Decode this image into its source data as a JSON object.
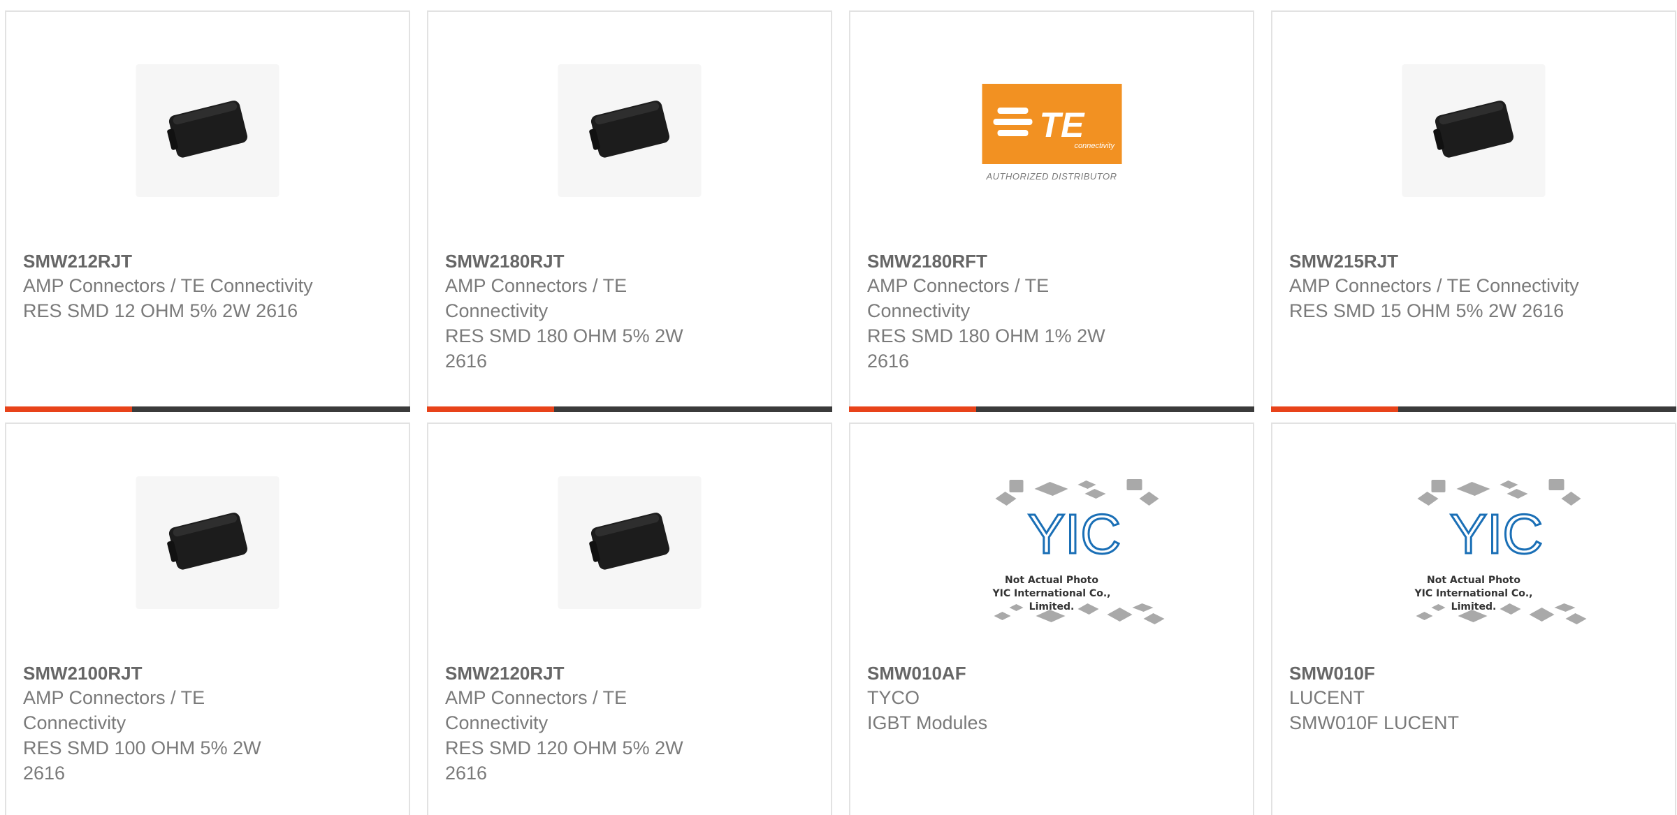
{
  "colors": {
    "accent": "#e8431a",
    "bar_dark": "#3b3b3b",
    "te_orange": "#f29122",
    "yic_blue": "#1a6fb6"
  },
  "products": [
    {
      "part": "SMW212RJT",
      "mfr": "AMP Connectors / TE Connectivity",
      "desc": "RES SMD 12 OHM 5% 2W 2616",
      "image": "resistor-chip"
    },
    {
      "part": "SMW2180RJT",
      "mfr": "AMP Connectors / TE Connectivity",
      "desc": "RES SMD 180 OHM 5% 2W 2616",
      "image": "resistor-chip"
    },
    {
      "part": "SMW2180RFT",
      "mfr": "AMP Connectors / TE Connectivity",
      "desc": "RES SMD 180 OHM 1% 2W 2616",
      "image": "te-logo"
    },
    {
      "part": "SMW215RJT",
      "mfr": "AMP Connectors / TE Connectivity",
      "desc": "RES SMD 15 OHM 5% 2W 2616",
      "image": "resistor-chip"
    },
    {
      "part": "SMW2100RJT",
      "mfr": "AMP Connectors / TE Connectivity",
      "desc": "RES SMD 100 OHM 5% 2W 2616",
      "image": "resistor-chip"
    },
    {
      "part": "SMW2120RJT",
      "mfr": "AMP Connectors / TE Connectivity",
      "desc": "RES SMD 120 OHM 5% 2W 2616",
      "image": "resistor-chip"
    },
    {
      "part": "SMW010AF",
      "mfr": "TYCO",
      "desc": "IGBT Modules",
      "image": "yic-placeholder"
    },
    {
      "part": "SMW010F",
      "mfr": "LUCENT",
      "desc": "SMW010F LUCENT",
      "image": "yic-placeholder"
    }
  ],
  "te_logo": {
    "caption": "AUTHORIZED DISTRIBUTOR",
    "sub": "connectivity",
    "mark": "TE"
  },
  "yic": {
    "mark": "YIC",
    "line1": "Not Actual Photo",
    "line2": "YIC International Co., Limited."
  }
}
